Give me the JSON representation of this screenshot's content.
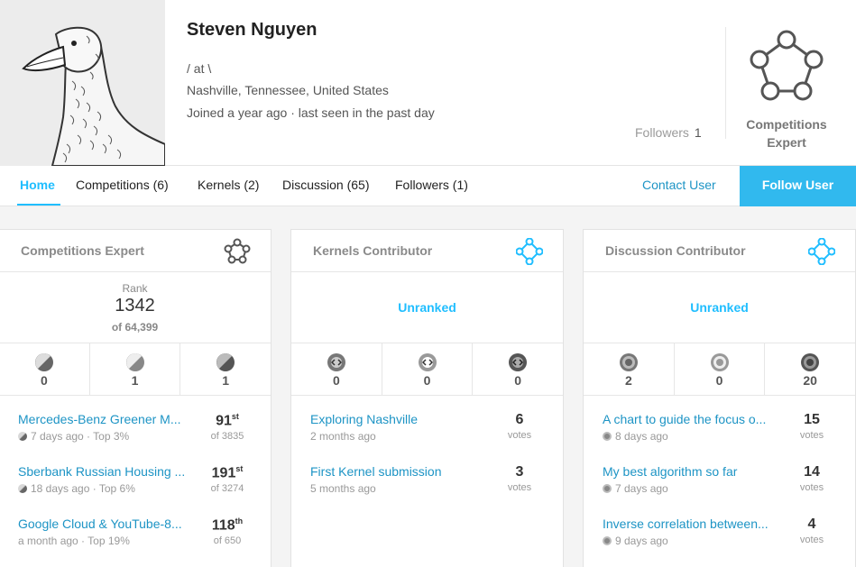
{
  "profile": {
    "name": "Steven Nguyen",
    "occupation": "/ at \\",
    "location": "Nashville, Tennessee, United States",
    "joined": "Joined a year ago · last seen in the past day",
    "followers_label": "Followers",
    "followers_count": "1",
    "tier_label_1": "Competitions",
    "tier_label_2": "Expert"
  },
  "nav": {
    "tabs": [
      {
        "label": "Home",
        "active": true
      },
      {
        "label": "Competitions (6)"
      },
      {
        "label": "Kernels (2)"
      },
      {
        "label": "Discussion (65)"
      },
      {
        "label": "Followers (1)"
      }
    ],
    "contact_label": "Contact User",
    "follow_label": "Follow User"
  },
  "cards": [
    {
      "title": "Competitions Expert",
      "rank_label": "Rank",
      "rank_value": "1342",
      "rank_of": "of 64,399",
      "medals": [
        "0",
        "1",
        "1"
      ],
      "items": [
        {
          "title": "Mercedes-Benz Greener M...",
          "sub": "7 days ago · Top 3%",
          "big": "91",
          "sup": "st",
          "small": "of 3835"
        },
        {
          "title": "Sberbank Russian Housing ...",
          "sub": "18 days ago · Top 6%",
          "big": "191",
          "sup": "st",
          "small": "of 3274"
        },
        {
          "title": "Google Cloud & YouTube-8...",
          "sub": "a month ago · Top 19%",
          "big": "118",
          "sup": "th",
          "small": "of 650"
        }
      ]
    },
    {
      "title": "Kernels Contributor",
      "unranked": "Unranked",
      "medals": [
        "0",
        "0",
        "0"
      ],
      "items": [
        {
          "title": "Exploring Nashville",
          "sub": "2 months ago",
          "big": "6",
          "small": "votes"
        },
        {
          "title": "First Kernel submission",
          "sub": "5 months ago",
          "big": "3",
          "small": "votes"
        }
      ]
    },
    {
      "title": "Discussion Contributor",
      "unranked": "Unranked",
      "medals": [
        "2",
        "0",
        "20"
      ],
      "items": [
        {
          "title": "A chart to guide the focus o...",
          "sub": "8 days ago",
          "big": "15",
          "small": "votes"
        },
        {
          "title": "My best algorithm so far",
          "sub": "7 days ago",
          "big": "14",
          "small": "votes"
        },
        {
          "title": "Inverse correlation between...",
          "sub": "9 days ago",
          "big": "4",
          "small": "votes"
        }
      ]
    }
  ],
  "colors": {
    "accent": "#20beff",
    "follow_button": "#31b9ee",
    "link": "#1d94c5"
  },
  "icons": {
    "tier": "competitions-expert-tier-icon",
    "card_heads": [
      "competitions-tier-icon",
      "kernels-tier-icon",
      "discussion-tier-icon"
    ]
  }
}
